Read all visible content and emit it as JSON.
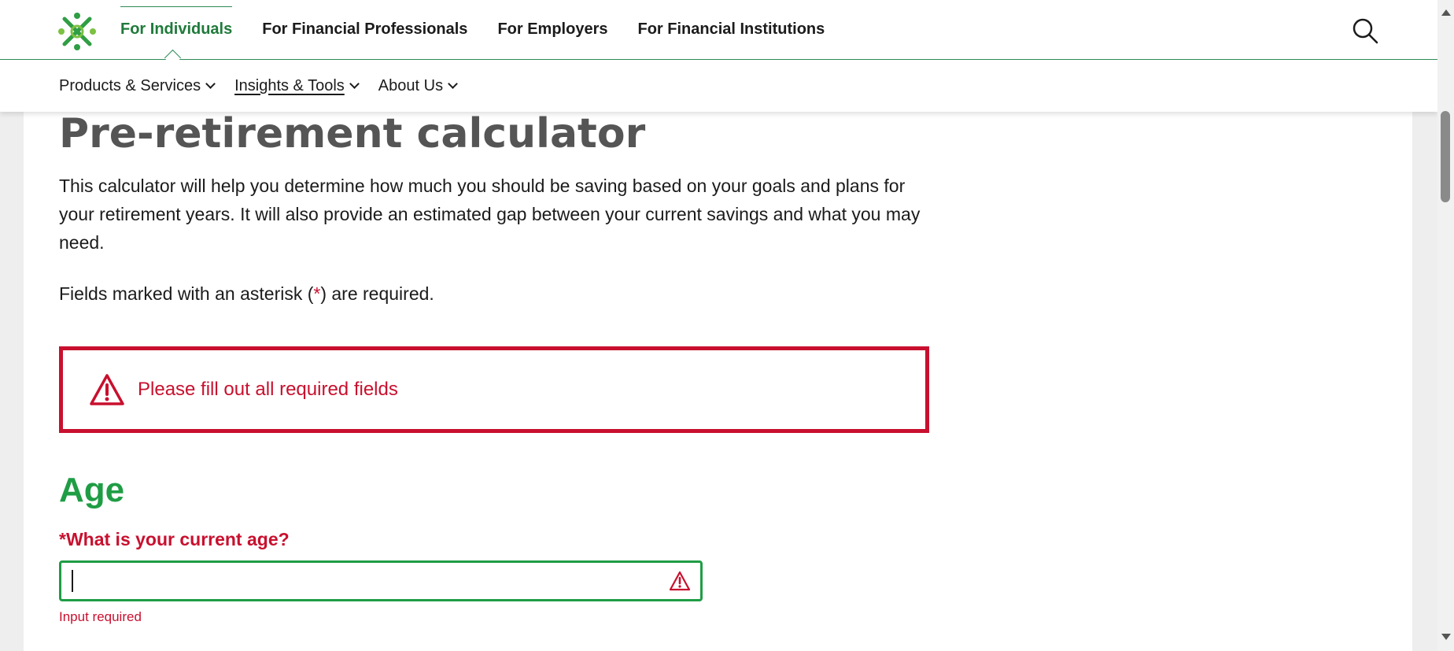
{
  "header": {
    "audience_tabs": [
      {
        "label": "For Individuals",
        "active": true
      },
      {
        "label": "For Financial Professionals",
        "active": false
      },
      {
        "label": "For Employers",
        "active": false
      },
      {
        "label": "For Financial Institutions",
        "active": false
      }
    ],
    "search_icon": "search-icon",
    "logo_icon": "logo-icon"
  },
  "subnav": {
    "items": [
      {
        "label": "Products & Services"
      },
      {
        "label": "Insights & Tools"
      },
      {
        "label": "About Us"
      }
    ]
  },
  "main": {
    "title": "Pre-retirement calculator",
    "intro": "This calculator will help you determine how much you should be saving based on your goals and plans for your retirement years. It will also provide an estimated gap between your current savings and what you may need.",
    "required_note_prefix": "Fields marked with an asterisk (",
    "required_note_asterisk": "*",
    "required_note_suffix": ") are required.",
    "error_banner": "Please fill out all required fields",
    "section_title": "Age",
    "question": "*What is your current age?",
    "age_value": "",
    "help_error": "Input required"
  },
  "colors": {
    "brand_green": "#1f9d45",
    "error_red": "#c8102e",
    "title_gray": "#555555"
  }
}
